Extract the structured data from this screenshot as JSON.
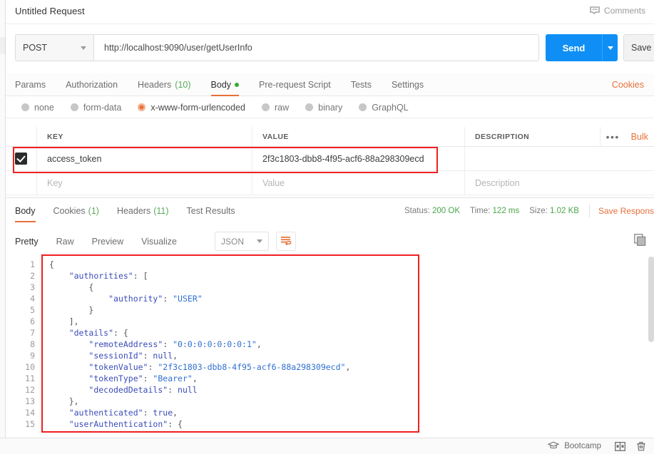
{
  "header": {
    "request_title": "Untitled Request",
    "comments_label": "Comments",
    "comments_icon": "comment-icon"
  },
  "url_bar": {
    "method": "POST",
    "method_caret_icon": "chevron-down-icon",
    "url": "http://localhost:9090/user/getUserInfo",
    "send_label": "Send",
    "send_caret_icon": "chevron-down-icon",
    "save_label": "Save"
  },
  "request_tabs": {
    "items": [
      {
        "label": "Params",
        "active": false
      },
      {
        "label": "Authorization",
        "active": false
      },
      {
        "label": "Headers",
        "count": "(10)",
        "active": false
      },
      {
        "label": "Body",
        "active": true,
        "dot": true
      },
      {
        "label": "Pre-request Script",
        "active": false
      },
      {
        "label": "Tests",
        "active": false
      },
      {
        "label": "Settings",
        "active": false
      }
    ],
    "cookies_link": "Cookies"
  },
  "body_types": {
    "options": [
      {
        "label": "none",
        "selected": false
      },
      {
        "label": "form-data",
        "selected": false
      },
      {
        "label": "x-www-form-urlencoded",
        "selected": true
      },
      {
        "label": "raw",
        "selected": false
      },
      {
        "label": "binary",
        "selected": false
      },
      {
        "label": "GraphQL",
        "selected": false
      }
    ]
  },
  "kv_table": {
    "columns": [
      "KEY",
      "VALUE",
      "DESCRIPTION"
    ],
    "more_icon": "ellipsis-icon",
    "bulk_edit_label": "Bulk",
    "rows": [
      {
        "checked": true,
        "key": "access_token",
        "value": "2f3c1803-dbb8-4f95-acf6-88a298309ecd",
        "description": ""
      }
    ],
    "placeholder_row": {
      "key_placeholder": "Key",
      "value_placeholder": "Value",
      "description_placeholder": "Description"
    }
  },
  "response": {
    "tabs": [
      {
        "label": "Body",
        "active": true
      },
      {
        "label": "Cookies",
        "count": "(1)",
        "active": false
      },
      {
        "label": "Headers",
        "count": "(11)",
        "active": false
      },
      {
        "label": "Test Results",
        "active": false
      }
    ],
    "meta": {
      "status_label": "Status:",
      "status_value": "200 OK",
      "time_label": "Time:",
      "time_value": "122 ms",
      "size_label": "Size:",
      "size_value": "1.02 KB"
    },
    "save_response_label": "Save Respons",
    "viewer": {
      "modes": [
        {
          "label": "Pretty",
          "active": true
        },
        {
          "label": "Raw",
          "active": false
        },
        {
          "label": "Preview",
          "active": false
        },
        {
          "label": "Visualize",
          "active": false
        }
      ],
      "format": "JSON",
      "format_caret_icon": "chevron-down-icon",
      "wrap_icon": "word-wrap-icon",
      "copy_icon": "copy-icon"
    },
    "line_numbers": [
      1,
      2,
      3,
      4,
      5,
      6,
      7,
      8,
      9,
      10,
      11,
      12,
      13,
      14,
      15
    ],
    "json_lines": [
      [
        {
          "t": "{",
          "c": "pun"
        }
      ],
      [
        {
          "t": "    ",
          "c": "pun"
        },
        {
          "t": "\"authorities\"",
          "c": "key"
        },
        {
          "t": ": [",
          "c": "pun"
        }
      ],
      [
        {
          "t": "        {",
          "c": "pun"
        }
      ],
      [
        {
          "t": "            ",
          "c": "pun"
        },
        {
          "t": "\"authority\"",
          "c": "key"
        },
        {
          "t": ": ",
          "c": "pun"
        },
        {
          "t": "\"USER\"",
          "c": "str"
        }
      ],
      [
        {
          "t": "        }",
          "c": "pun"
        }
      ],
      [
        {
          "t": "    ],",
          "c": "pun"
        }
      ],
      [
        {
          "t": "    ",
          "c": "pun"
        },
        {
          "t": "\"details\"",
          "c": "key"
        },
        {
          "t": ": {",
          "c": "pun"
        }
      ],
      [
        {
          "t": "        ",
          "c": "pun"
        },
        {
          "t": "\"remoteAddress\"",
          "c": "key"
        },
        {
          "t": ": ",
          "c": "pun"
        },
        {
          "t": "\"0:0:0:0:0:0:0:1\"",
          "c": "str"
        },
        {
          "t": ",",
          "c": "pun"
        }
      ],
      [
        {
          "t": "        ",
          "c": "pun"
        },
        {
          "t": "\"sessionId\"",
          "c": "key"
        },
        {
          "t": ": ",
          "c": "pun"
        },
        {
          "t": "null",
          "c": "lit"
        },
        {
          "t": ",",
          "c": "pun"
        }
      ],
      [
        {
          "t": "        ",
          "c": "pun"
        },
        {
          "t": "\"tokenValue\"",
          "c": "key"
        },
        {
          "t": ": ",
          "c": "pun"
        },
        {
          "t": "\"2f3c1803-dbb8-4f95-acf6-88a298309ecd\"",
          "c": "str"
        },
        {
          "t": ",",
          "c": "pun"
        }
      ],
      [
        {
          "t": "        ",
          "c": "pun"
        },
        {
          "t": "\"tokenType\"",
          "c": "key"
        },
        {
          "t": ": ",
          "c": "pun"
        },
        {
          "t": "\"Bearer\"",
          "c": "str"
        },
        {
          "t": ",",
          "c": "pun"
        }
      ],
      [
        {
          "t": "        ",
          "c": "pun"
        },
        {
          "t": "\"decodedDetails\"",
          "c": "key"
        },
        {
          "t": ": ",
          "c": "pun"
        },
        {
          "t": "null",
          "c": "lit"
        }
      ],
      [
        {
          "t": "    },",
          "c": "pun"
        }
      ],
      [
        {
          "t": "    ",
          "c": "pun"
        },
        {
          "t": "\"authenticated\"",
          "c": "key"
        },
        {
          "t": ": ",
          "c": "pun"
        },
        {
          "t": "true",
          "c": "lit"
        },
        {
          "t": ",",
          "c": "pun"
        }
      ],
      [
        {
          "t": "    ",
          "c": "pun"
        },
        {
          "t": "\"userAuthentication\"",
          "c": "key"
        },
        {
          "t": ": {",
          "c": "pun"
        }
      ]
    ]
  },
  "status_bar": {
    "bootcamp_label": "Bootcamp",
    "bootcamp_icon": "graduation-cap-icon",
    "layout_icon": "two-pane-layout-icon",
    "trash_icon": "trash-icon"
  },
  "colors": {
    "accent_orange": "#e8703a",
    "send_blue": "#0f8ff5",
    "status_green": "#4aa64a",
    "highlight_red": "#ef2020"
  }
}
